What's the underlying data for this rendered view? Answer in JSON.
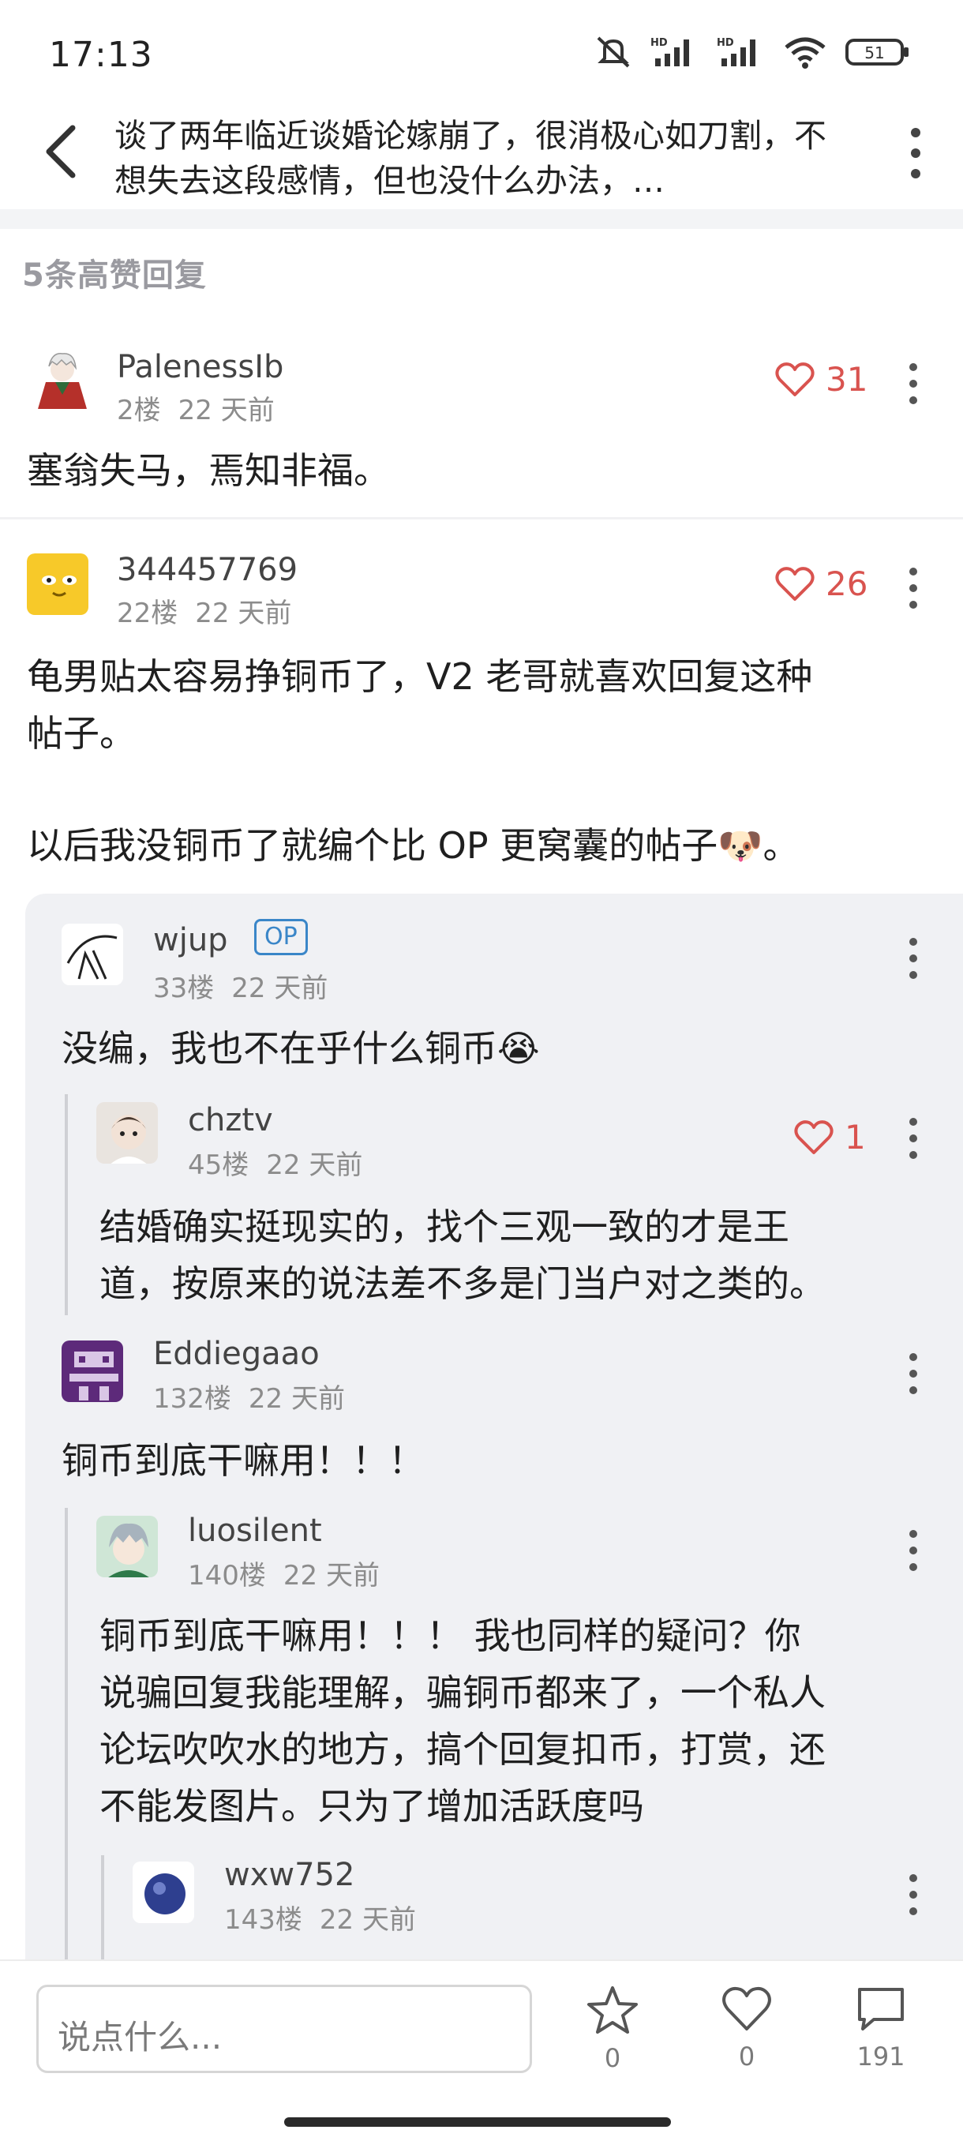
{
  "status_bar": {
    "time": "17:13",
    "battery": "51",
    "icons": [
      "mute-icon",
      "hd-signal-icon",
      "hd-signal-icon",
      "wifi-icon",
      "battery-icon"
    ]
  },
  "header": {
    "title": "谈了两年临近谈婚论嫁崩了，很消极心如刀割，不想失去这段感情，但也没什么办法，…"
  },
  "section_title": "5条高赞回复",
  "comments": [
    {
      "username": "PalenessIb",
      "floor": "2楼",
      "time": "22 天前",
      "likes": "31",
      "text": "塞翁失马，焉知非福。"
    },
    {
      "username": "344457769",
      "floor": "22楼",
      "time": "22 天前",
      "likes": "26",
      "text_line1": "龟男贴太容易挣铜币了，V2 老哥就喜欢回复这种",
      "text_line2": "帖子。",
      "text_line3": "以后我没铜币了就编个比 OP 更窝囊的帖子🐶。"
    }
  ],
  "replies": [
    {
      "username": "wjup",
      "badge": "OP",
      "floor": "33楼",
      "time": "22 天前",
      "text": "没编，我也不在乎什么铜币😭"
    },
    {
      "username": "chztv",
      "floor": "45楼",
      "time": "22 天前",
      "likes": "1",
      "text_line1": "结婚确实挺现实的，找个三观一致的才是王",
      "text_line2": "道，按原来的说法差不多是门当户对之类的。"
    },
    {
      "username": "Eddiegaao",
      "floor": "132楼",
      "time": "22 天前",
      "text": "铜币到底干嘛用！！！"
    },
    {
      "username": "luosilent",
      "floor": "140楼",
      "time": "22 天前",
      "text_line1": "铜币到底干嘛用！！！ 我也同样的疑问？你",
      "text_line2": "说骗回复我能理解，骗铜币都来了，一个私人",
      "text_line3": "论坛吹吹水的地方，搞个回复扣币，打赏，还",
      "text_line4": "不能发图片。只为了增加活跃度吗"
    },
    {
      "username": "wxw752",
      "floor": "143楼",
      "time": "22 天前"
    }
  ],
  "bottom_bar": {
    "input_placeholder": "说点什么...",
    "favorites": "0",
    "likes": "0",
    "comments": "191"
  },
  "colors": {
    "accent_like": "#d9534f",
    "op_badge": "#3a86c8",
    "thread_bg": "#f0f1f4"
  }
}
